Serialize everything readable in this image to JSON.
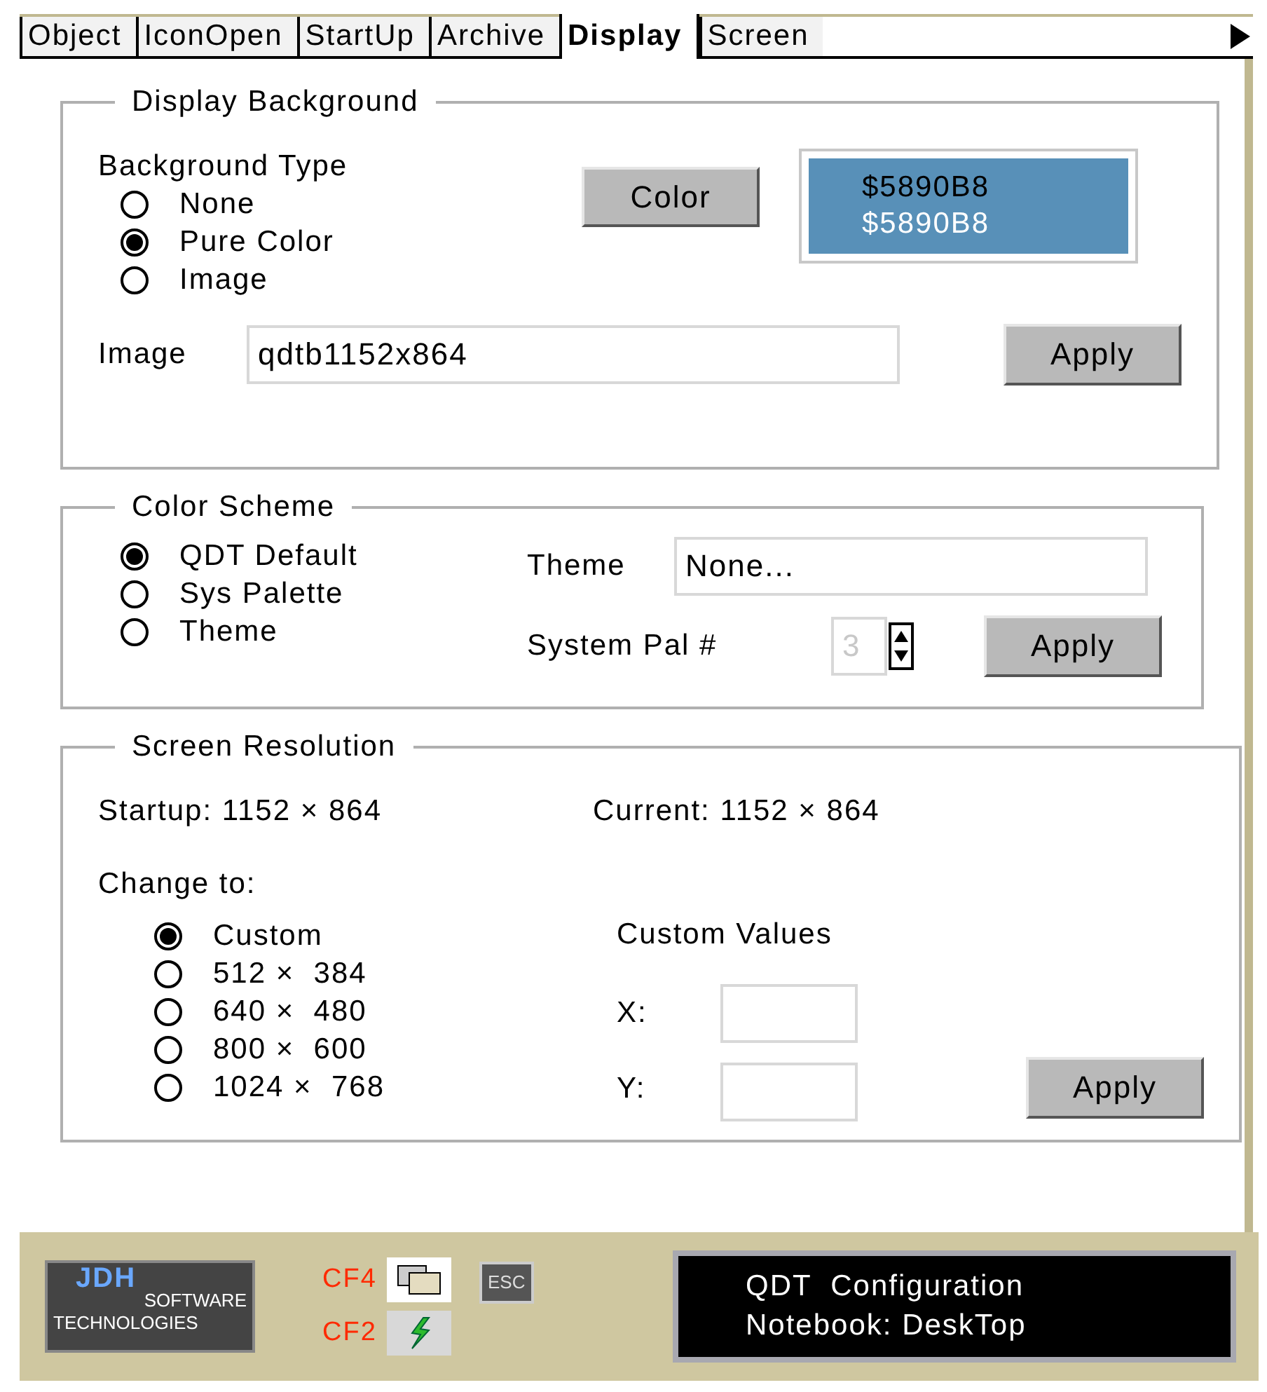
{
  "tabs": [
    {
      "label": "Object",
      "selected": false
    },
    {
      "label": "IconOpen",
      "selected": false
    },
    {
      "label": "StartUp",
      "selected": false
    },
    {
      "label": "Archive",
      "selected": false
    },
    {
      "label": "Display",
      "selected": true
    },
    {
      "label": "Screen",
      "selected": false
    }
  ],
  "display_background": {
    "title": "Display Background",
    "type_label": "Background Type",
    "options": [
      {
        "label": "None",
        "selected": false
      },
      {
        "label": "Pure Color",
        "selected": true
      },
      {
        "label": "Image",
        "selected": false
      }
    ],
    "color_button": "Color",
    "swatch": {
      "color": "#5890b8",
      "text_dark": "$5890B8",
      "text_light": "$5890B8"
    },
    "image_label": "Image",
    "image_value": "qdtb1152x864",
    "apply": "Apply"
  },
  "color_scheme": {
    "title": "Color Scheme",
    "options": [
      {
        "label": "QDT Default",
        "selected": true
      },
      {
        "label": "Sys Palette",
        "selected": false
      },
      {
        "label": "Theme",
        "selected": false
      }
    ],
    "theme_label": "Theme",
    "theme_value": "None...",
    "pal_label": "System Pal #",
    "pal_value": "3",
    "pal_disabled": true,
    "apply": "Apply"
  },
  "screen_resolution": {
    "title": "Screen Resolution",
    "startup": "Startup: 1152 × 864",
    "current": "Current: 1152 × 864",
    "change_label": "Change to:",
    "options": [
      {
        "label": "Custom",
        "selected": true
      },
      {
        "label": "512 ×  384",
        "selected": false
      },
      {
        "label": "640 ×  480",
        "selected": false
      },
      {
        "label": "800 ×  600",
        "selected": false
      },
      {
        "label": "1024 ×  768",
        "selected": false
      }
    ],
    "custom_label": "Custom Values",
    "x_label": "X:",
    "y_label": "Y:",
    "apply": "Apply"
  },
  "footer": {
    "logo": {
      "line1": "JDH",
      "line2": "SOFTWARE",
      "line3": "TECHNOLOGIES"
    },
    "keys": [
      {
        "label": "CF4",
        "kind": "windows"
      },
      {
        "label": "CF2",
        "kind": "run"
      }
    ],
    "esc": "ESC",
    "status": [
      "QDT  Configuration",
      "Notebook: DeskTop"
    ]
  }
}
